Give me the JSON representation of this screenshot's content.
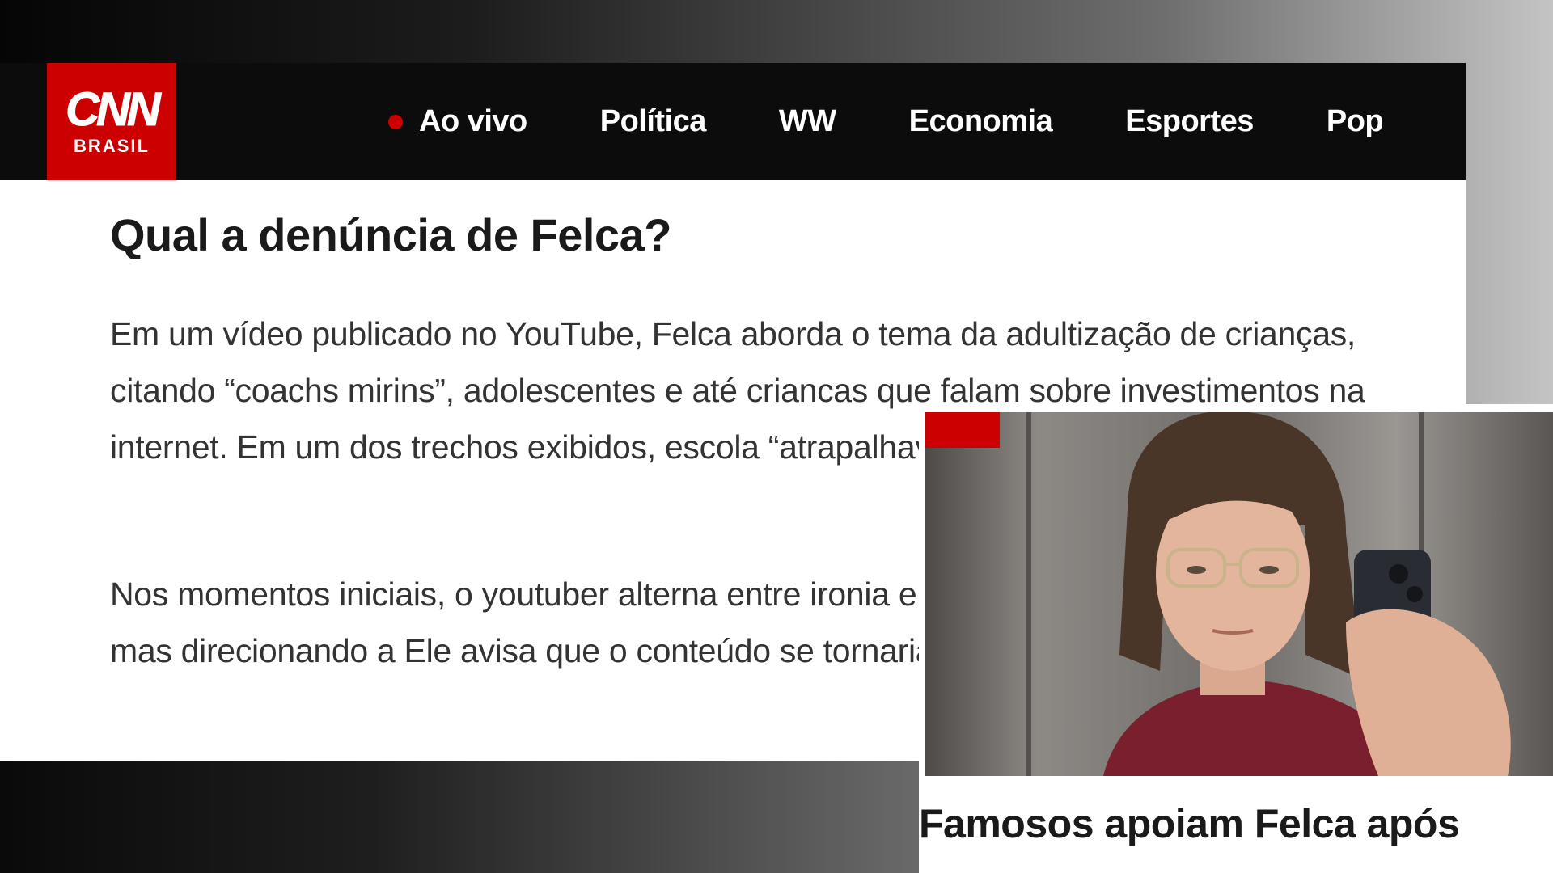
{
  "brand": {
    "logo_main": "CNN",
    "logo_sub": "BRASIL"
  },
  "nav": {
    "items": [
      {
        "label": "Ao vivo",
        "live": true
      },
      {
        "label": "Política"
      },
      {
        "label": "WW"
      },
      {
        "label": "Economia"
      },
      {
        "label": "Esportes"
      },
      {
        "label": "Pop"
      }
    ]
  },
  "article": {
    "heading": "Qual a denúncia de Felca?",
    "paragraph1": "Em um vídeo publicado no YouTube, Felca aborda o tema da adultização de crianças, citando “coachs mirins”, adolescentes e até criancas que falam sobre investimentos na internet. Em um dos trechos exibidos, escola “atrapalhava o desenvolvimento” dele.",
    "paragraph2": "Nos momentos iniciais, o youtuber alterna entre ironia e o tom característico de seu canal, mas direcionando a Ele avisa que o conteúdo se tornaria “mais sério”"
  },
  "card": {
    "title": "Famosos apoiam Felca após"
  },
  "colors": {
    "brand_red": "#cc0000",
    "navbar_bg": "#0c0c0c"
  }
}
